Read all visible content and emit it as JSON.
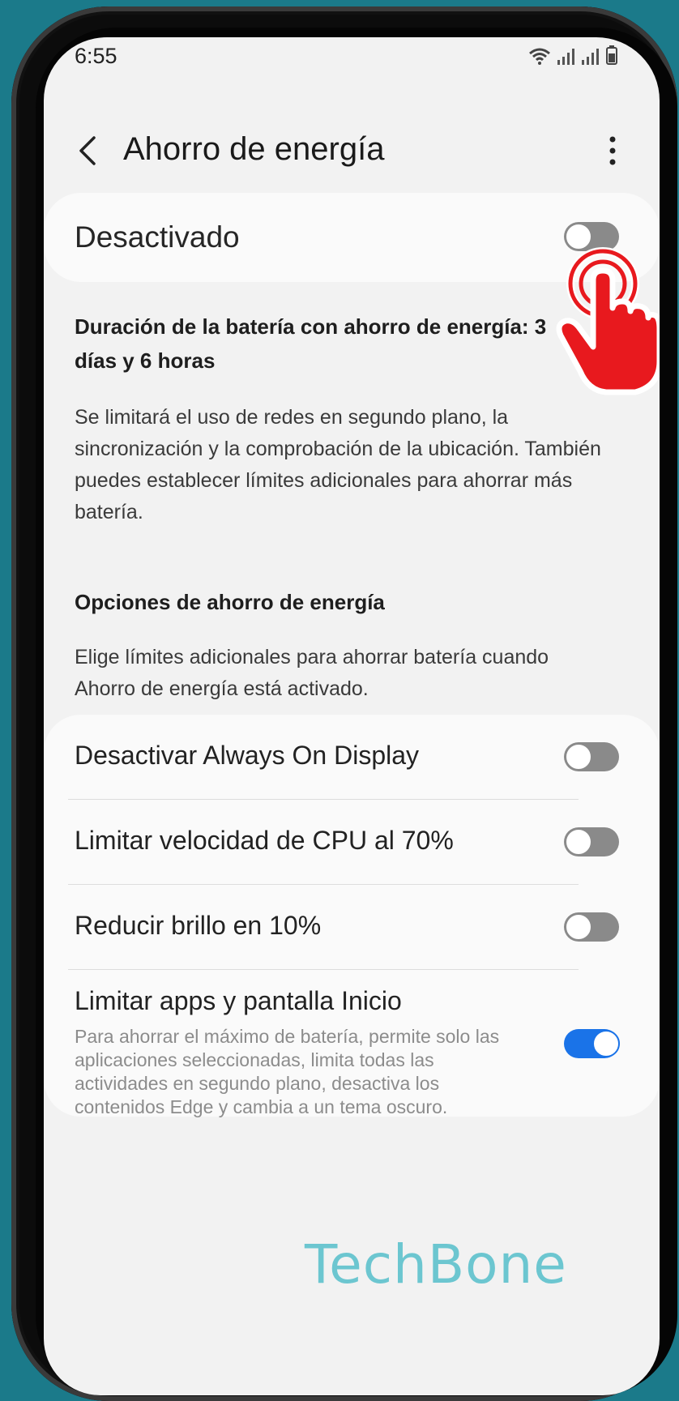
{
  "status": {
    "time": "6:55",
    "icons": [
      "wifi-icon",
      "signal-icon",
      "signal-icon",
      "battery-icon"
    ]
  },
  "appbar": {
    "title": "Ahorro de energía",
    "back_icon": "back-chevron-icon",
    "more_icon": "more-vert-icon"
  },
  "master": {
    "label": "Desactivado",
    "enabled": false
  },
  "info": {
    "heading": "Duración de la batería con ahorro de energía: 3 días y 6 horas",
    "body": "Se limitará el uso de redes en segundo plano, la sincronización y la comprobación de la ubicación. También puedes establecer límites adicionales para ahorrar más batería."
  },
  "options_section": {
    "heading": "Opciones de ahorro de energía",
    "body": "Elige límites adicionales para ahorrar batería cuando Ahorro de energía está activado."
  },
  "options": [
    {
      "label": "Desactivar Always On Display",
      "enabled": false
    },
    {
      "label": "Limitar velocidad de CPU al 70%",
      "enabled": false
    },
    {
      "label": "Reducir brillo en 10%",
      "enabled": false
    },
    {
      "label": "Limitar apps y pantalla Inicio",
      "description": "Para ahorrar el máximo de batería, permite solo las aplicaciones seleccionadas, limita todas las actividades en segundo plano, desactiva los contenidos Edge y cambia a un tema oscuro.",
      "enabled": true
    }
  ],
  "watermark": "TechBone",
  "colors": {
    "accent": "#1a73e8",
    "toggle_off": "#8a8a8a",
    "hand_red": "#e8191e",
    "watermark": "#6cc6d0"
  }
}
